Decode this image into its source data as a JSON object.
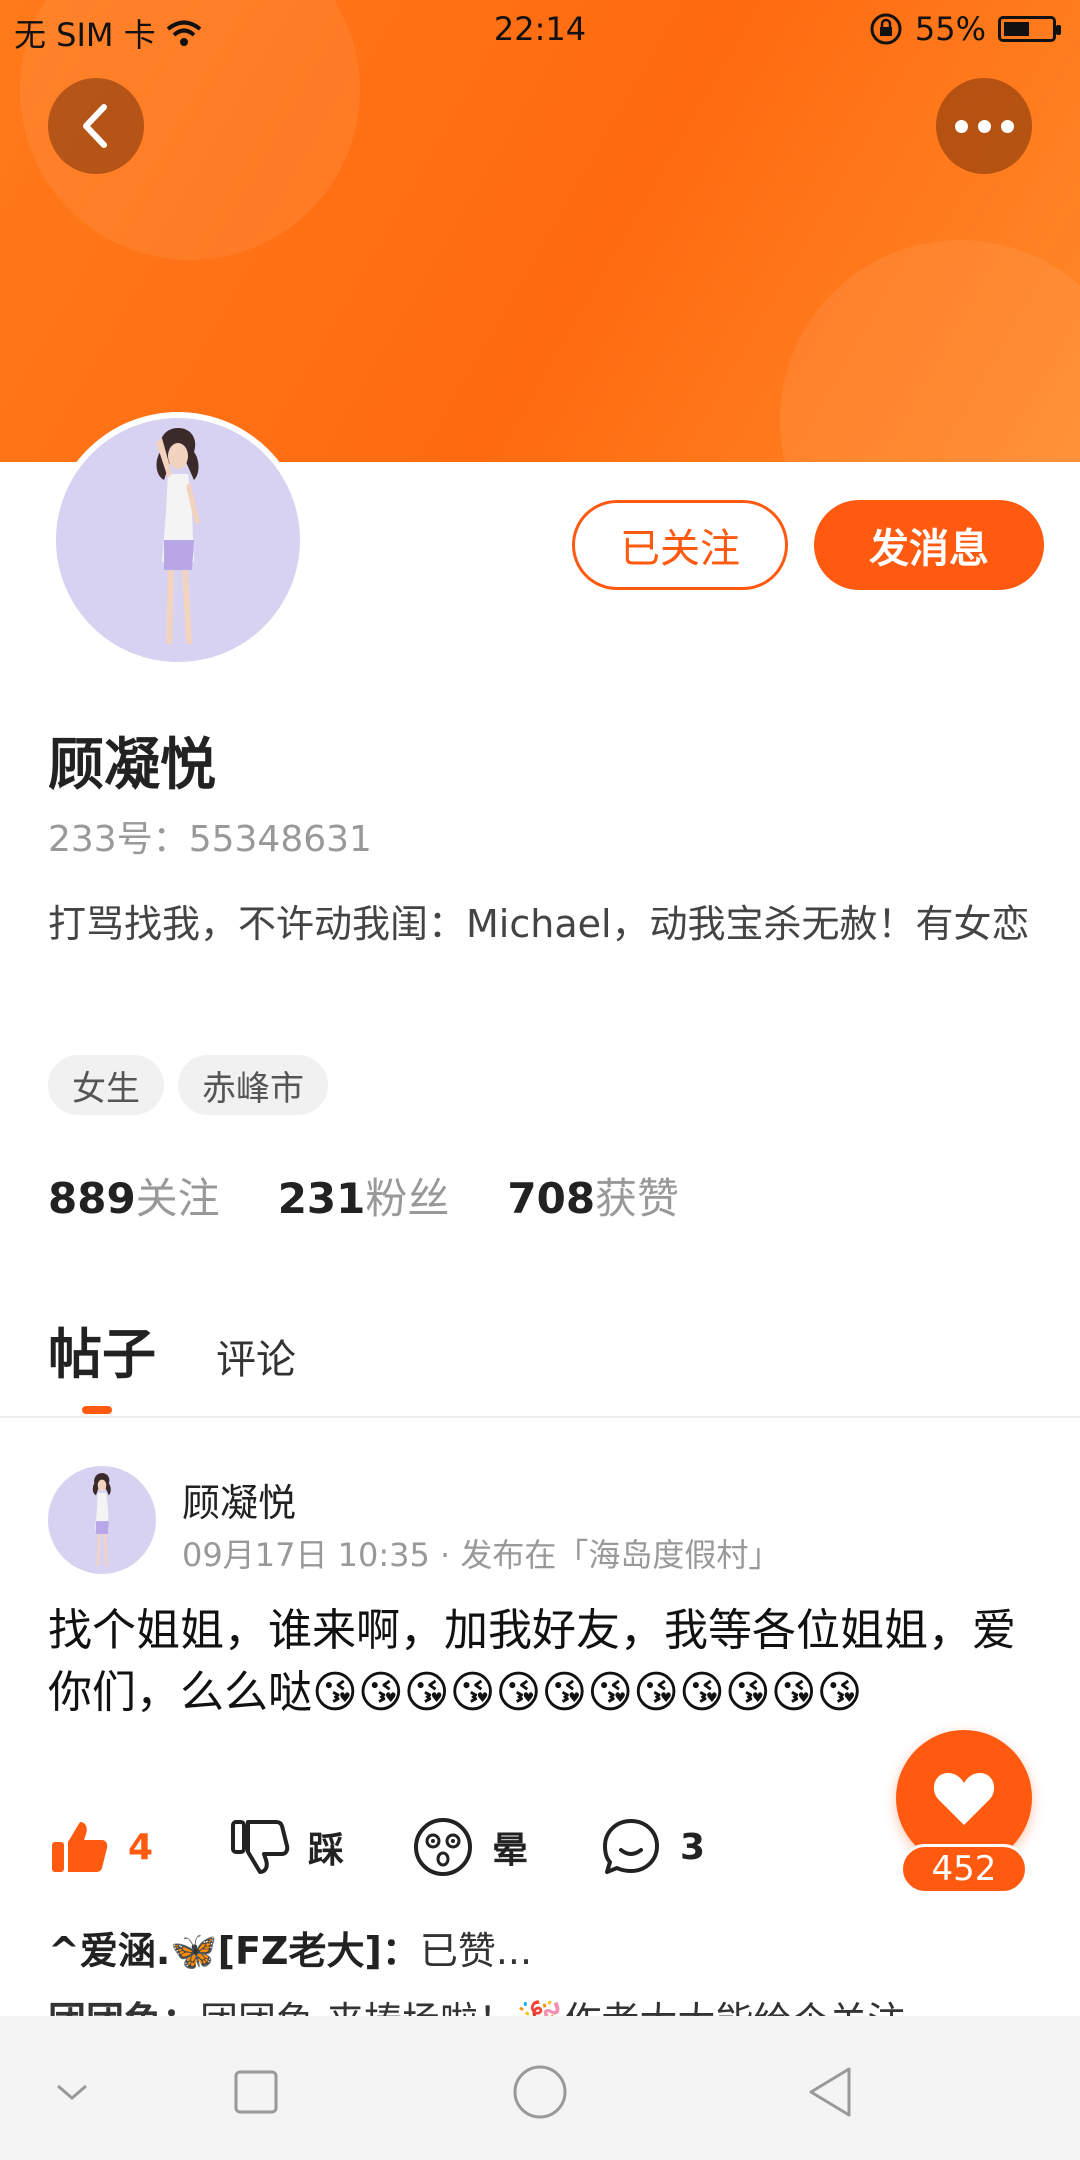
{
  "status_bar": {
    "carrier": "无 SIM 卡",
    "time": "22:14",
    "battery_percent": "55%",
    "battery_level": 0.55
  },
  "header": {
    "back_icon": "chevron-left-icon",
    "more_icon": "more-dots-icon"
  },
  "profile": {
    "name": "顾凝悦",
    "uid": "233号：55348631",
    "bio": "打骂找我，不许动我闺：Michael，动我宝杀无赦！有女恋",
    "tags": [
      "女生",
      "赤峰市"
    ],
    "followed_label": "已关注",
    "message_label": "发消息",
    "stats": [
      {
        "num": "889",
        "label": "关注"
      },
      {
        "num": "231",
        "label": "粉丝"
      },
      {
        "num": "708",
        "label": "获赞"
      }
    ]
  },
  "tabs": {
    "posts": "帖子",
    "comments": "评论"
  },
  "post": {
    "author": "顾凝悦",
    "meta": "09月17日 10:35 · 发布在「海岛度假村」",
    "text": "找个姐姐，谁来啊，加我好友，我等各位姐姐，爱你们，么么哒😘😘😘😘😘😘😘😘😘😘😘😘",
    "like_count": "4",
    "dislike_label": "踩",
    "dizzy_label": "晕",
    "comment_count": "3",
    "fab_count": "452"
  },
  "comments": [
    {
      "user": "^爱涵.🦋[FZ老大]：",
      "text": "已赞..."
    },
    {
      "user": "团团鱼：",
      "text": "团团鱼 来捧场啦！🎉作者大大能给个关注..."
    }
  ],
  "colors": {
    "accent": "#ff5a10",
    "header": "#ff6a10"
  }
}
